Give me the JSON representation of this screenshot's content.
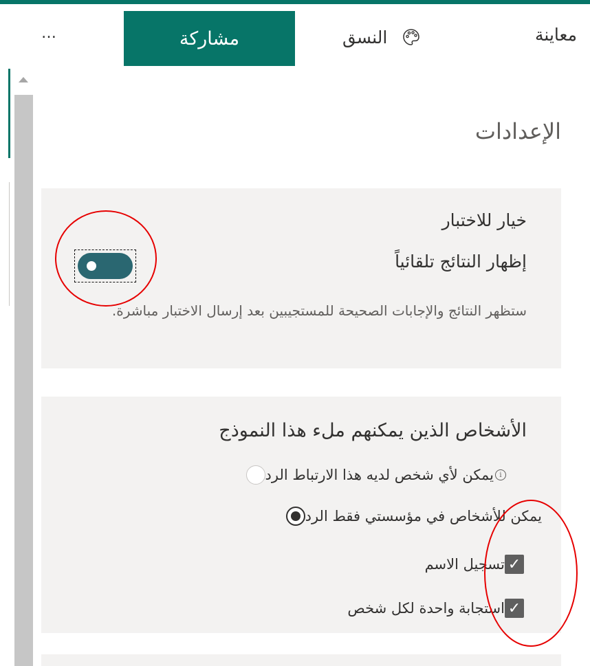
{
  "toolbar": {
    "more_label": "…",
    "share_label": "مشاركة",
    "theme_label": "النسق",
    "preview_label": "معاينة",
    "theme_icon": "palette-icon"
  },
  "settings": {
    "title": "الإعدادات"
  },
  "quiz_option": {
    "heading": "خيار للاختبار",
    "toggle_label": "إظهار النتائج تلقائياً",
    "toggle_on": true,
    "description": "ستظهر النتائج والإجابات الصحيحة للمستجيبين بعد إرسال الاختبار مباشرة."
  },
  "who_can_fill": {
    "heading": "الأشخاص الذين يمكنهم ملء هذا النموذج",
    "options": [
      {
        "label": "يمكن لأي شخص لديه هذا الارتباط الرد",
        "selected": false,
        "info_icon": "info-icon"
      },
      {
        "label": "يمكن للأشخاص في مؤسستي فقط الرد",
        "selected": true
      }
    ],
    "checkboxes": [
      {
        "label": "تسجيل الاسم",
        "checked": true
      },
      {
        "label": "استجابة واحدة لكل شخص",
        "checked": true
      }
    ]
  },
  "colors": {
    "accent": "#077568",
    "toggle": "#2a6771",
    "card_bg": "#f3f2f1",
    "annotation": "#e60000"
  }
}
